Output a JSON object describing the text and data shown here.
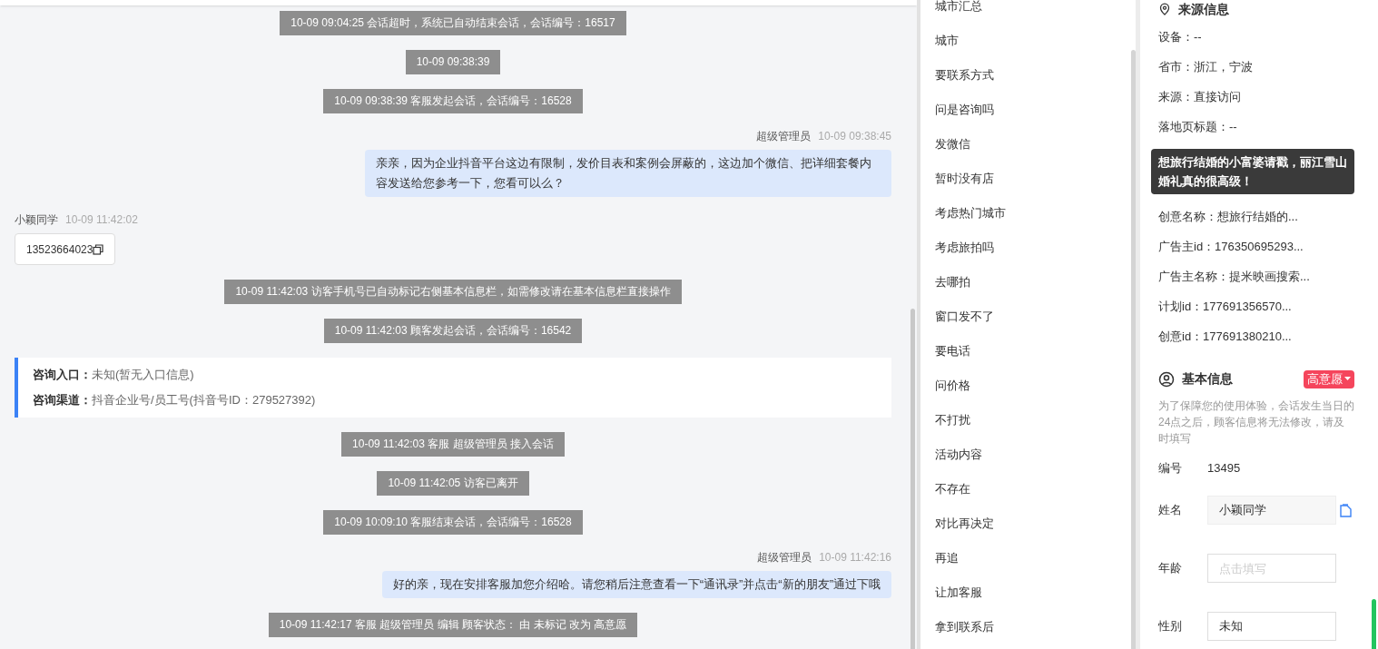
{
  "chat": {
    "messages": [
      {
        "kind": "notice",
        "text": "10-09 09:04:25 会话超时，系统已自动结束会话，会话编号：16517"
      },
      {
        "kind": "notice",
        "text": "10-09 09:38:39"
      },
      {
        "kind": "notice",
        "text": "10-09 09:38:39 客服发起会话，会话编号：16528"
      },
      {
        "kind": "agent",
        "name": "超级管理员",
        "time": "10-09 09:38:45",
        "text": "亲亲，因为企业抖音平台这边有限制，发价目表和案例会屏蔽的，这边加个微信、把详细套餐内容发送给您参考一下，您看可以么？"
      },
      {
        "kind": "visitor",
        "name": "小颖同学",
        "time": "10-09 11:42:02",
        "text": "13523664023"
      },
      {
        "kind": "notice",
        "text": "10-09 11:42:03 访客手机号已自动标记右侧基本信息栏，如需修改请在基本信息栏直接操作"
      },
      {
        "kind": "notice",
        "text": "10-09 11:42:03 顾客发起会话，会话编号：16542"
      },
      {
        "kind": "card",
        "rows": [
          {
            "label": "咨询入口：",
            "value": "未知(暂无入口信息)"
          },
          {
            "label": "咨询渠道：",
            "value": "抖音企业号/员工号(抖音号ID：279527392)"
          }
        ]
      },
      {
        "kind": "notice",
        "text": "10-09 11:42:03 客服 超级管理员 接入会话"
      },
      {
        "kind": "notice",
        "text": "10-09 11:42:05 访客已离开"
      },
      {
        "kind": "notice",
        "text": "10-09 10:09:10 客服结束会话，会话编号：16528"
      },
      {
        "kind": "agent",
        "name": "超级管理员",
        "time": "10-09 11:42:16",
        "text": "好的亲，现在安排客服加您介绍哈。请您稍后注意查看一下“通讯录”并点击“新的朋友”通过下哦"
      },
      {
        "kind": "notice",
        "text": "10-09 11:42:17 客服 超级管理员 编辑 顾客状态： 由 未标记 改为 高意愿"
      }
    ]
  },
  "quick_replies": [
    "城市汇总",
    "城市",
    "要联系方式",
    "问是咨询吗",
    "发微信",
    "暂时没有店",
    "考虑热门城市",
    "考虑旅拍吗",
    "去哪拍",
    "窗口发不了",
    "要电话",
    "问价格",
    "不打扰",
    "活动内容",
    "不存在",
    "对比再决定",
    "再追",
    "让加客服",
    "拿到联系后"
  ],
  "source_info": {
    "title": "来源信息",
    "items": [
      {
        "kind": "row",
        "text": "设备：--"
      },
      {
        "kind": "row",
        "text": "省市：浙江，宁波"
      },
      {
        "kind": "row",
        "text": "来源：直接访问"
      },
      {
        "kind": "row",
        "text": "落地页标题：--"
      },
      {
        "kind": "tooltip",
        "text": "想旅行结婚的小富婆请戳，丽江雪山婚礼真的很高级！"
      },
      {
        "kind": "row",
        "text": "创意名称：想旅行结婚的..."
      },
      {
        "kind": "row",
        "text": "广告主id：176350695293..."
      },
      {
        "kind": "row",
        "text": "广告主名称：提米映画搜索..."
      },
      {
        "kind": "row",
        "text": "计划id：177691356570..."
      },
      {
        "kind": "row",
        "text": "创意id：177691380210..."
      }
    ]
  },
  "basic_info": {
    "title": "基本信息",
    "status": "高意愿",
    "note": "为了保障您的使用体验，会话发生当日的24点之后，顾客信息将无法修改，请及时填写",
    "fields": [
      {
        "kind": "text",
        "label": "编号",
        "value": "13495"
      },
      {
        "kind": "copy",
        "label": "姓名",
        "value": "小颖同学"
      },
      {
        "kind": "input",
        "label": "年龄",
        "placeholder": "点击填写"
      },
      {
        "kind": "input",
        "label": "性别",
        "value": "未知"
      }
    ]
  }
}
